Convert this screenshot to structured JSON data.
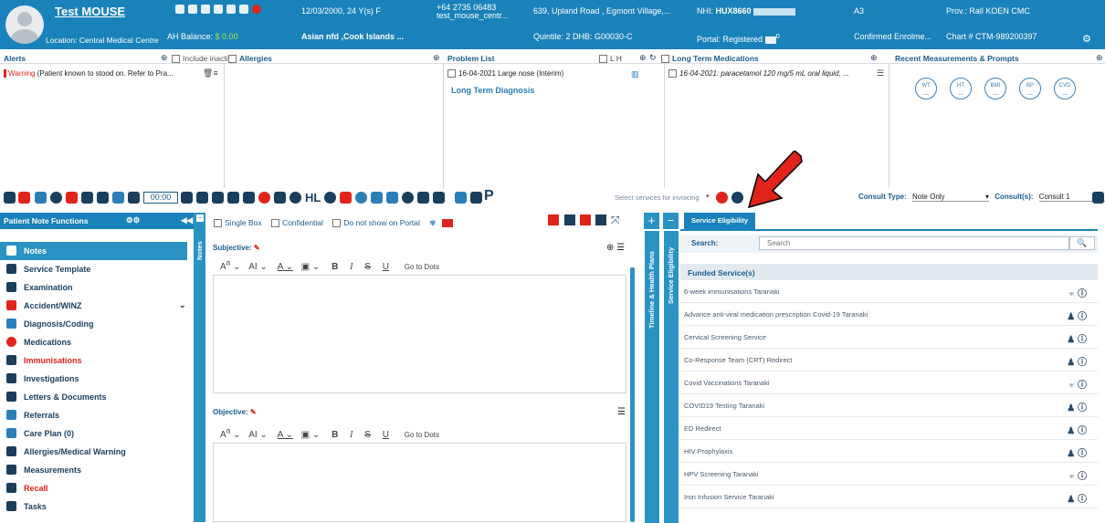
{
  "patient": {
    "name": "Test MOUSE",
    "location": "Location: Central Medical Centre",
    "ah_balance_label": "AH Balance:",
    "ah_balance_value": "$ 0.00",
    "dob_age": "12/03/2000, 24 Y(s) F",
    "ethnicity": "Asian nfd ,Cook Islands ...",
    "phone": "+64 2735 06483",
    "email": "test_mouse_centr...",
    "address": "639, Upland Road , Egmont Village,...",
    "quintile": "Quintile: 2 DHB: G00030-C",
    "nhi_label": "NHI:",
    "nhi": "HUX8660",
    "portal_label": "Portal:",
    "portal": "Registered",
    "portal_count": "0",
    "room": "A3",
    "enrolment": "Confirmed Enrolme...",
    "provider": "Prov.: Rall KOEN CMC",
    "chart": "Chart # CTM-989200397"
  },
  "panels": {
    "alerts": {
      "title": "Alerts",
      "include_inactive": "Include inactive",
      "item_tag": "Warning",
      "item_text": "(Patient known to stood on. Refer to Pra..."
    },
    "allergies": {
      "title": "Allergies"
    },
    "problems": {
      "title": "Problem List",
      "flags": "L   H",
      "item": "16-04-2021 Large nose (Interim)",
      "ltd": "Long Term Diagnosis"
    },
    "medications": {
      "title": "Long Term Medications",
      "item": "16-04-2021: paracetamol 120 mg/5 mL oral liquid, ..."
    },
    "measurements": {
      "title": "Recent Measurements & Prompts",
      "circles": [
        "WT",
        "HT",
        "BMI",
        "BP",
        "CVD"
      ],
      "circle_value": "---"
    }
  },
  "toolbar": {
    "timer": "00:00",
    "hl": "HL",
    "invoice_placeholder": "Select services for invoicing",
    "consult_type_label": "Consult Type:",
    "consult_type_value": "Note Only",
    "consults_label": "Consult(s):",
    "consults_value": "Consult 1"
  },
  "left": {
    "header": "Patient Note Functions",
    "items": [
      {
        "label": "Notes",
        "icon": "notes-icon",
        "active": true
      },
      {
        "label": "Service Template",
        "icon": "template-icon"
      },
      {
        "label": "Examination",
        "icon": "examination-icon"
      },
      {
        "label": "Accident/WINZ",
        "icon": "acc-icon",
        "chevron": true
      },
      {
        "label": "Diagnosis/Coding",
        "icon": "diagnosis-icon"
      },
      {
        "label": "Medications",
        "icon": "pill-icon"
      },
      {
        "label": "Immunisations",
        "icon": "syringe-icon",
        "red": true
      },
      {
        "label": "Investigations",
        "icon": "lab-icon"
      },
      {
        "label": "Letters & Documents",
        "icon": "document-icon"
      },
      {
        "label": "Referrals",
        "icon": "arrow-icon"
      },
      {
        "label": "Care Plan (0)",
        "icon": "care-plan-icon"
      },
      {
        "label": "Allergies/Medical Warning",
        "icon": "allergy-icon"
      },
      {
        "label": "Measurements",
        "icon": "measure-icon"
      },
      {
        "label": "Recall",
        "icon": "recall-icon",
        "red": true
      },
      {
        "label": "Tasks",
        "icon": "tasks-icon"
      }
    ],
    "strip_label": "Notes"
  },
  "notes": {
    "single_box": "Single Box",
    "confidential": "Confidential",
    "portal": "Do not show on Portal",
    "subjective_label": "Subjective:",
    "objective_label": "Objective:",
    "font_size": "A",
    "font_ai": "AI",
    "bold": "B",
    "italic": "I",
    "strike": "S",
    "underline": "U",
    "goto_dots": "Go to Dots"
  },
  "side_strips": {
    "timeline": "Timeline & Health Plans",
    "eligibility": "Service Eligibility"
  },
  "services": {
    "tab": "Service Eligibility",
    "search_label": "Search:",
    "search_placeholder": "Search",
    "funded_header": "Funded Service(s)",
    "items": [
      {
        "name": "6-week immunisations Taranaki",
        "icon": "immunise-icon"
      },
      {
        "name": "Advance anti-viral medication prescription Covid-19 Taranaki",
        "icon": "person-icon"
      },
      {
        "name": "Cervical Screening Service",
        "icon": "person-icon"
      },
      {
        "name": "Co-Response Team (CRT) Redirect",
        "icon": "person-icon"
      },
      {
        "name": "Covid Vaccinations Taranaki",
        "icon": "immunise-icon"
      },
      {
        "name": "COVID19 Testing Taranaki",
        "icon": "person-icon"
      },
      {
        "name": "ED Redirect",
        "icon": "person-icon"
      },
      {
        "name": "HIV Prophylaxis",
        "icon": "person-icon"
      },
      {
        "name": "HPV Screening Taranaki",
        "icon": "immunise-icon"
      },
      {
        "name": "Iron Infusion Service Taranaki",
        "icon": "person-icon"
      }
    ]
  },
  "colors": {
    "primary": "#1a82ba",
    "accent_red": "#e0241b",
    "link": "#1a5e8e"
  }
}
